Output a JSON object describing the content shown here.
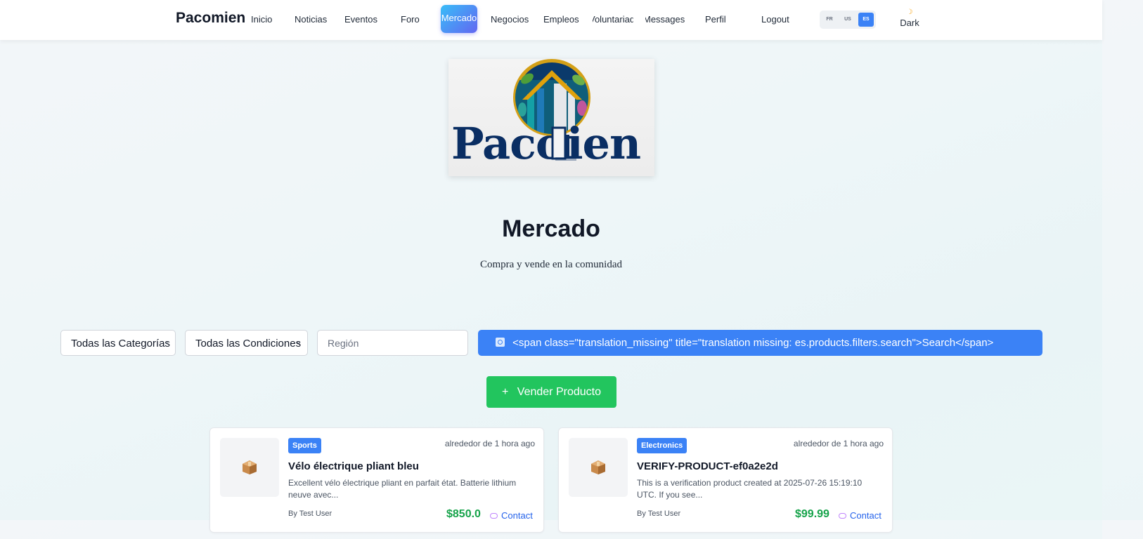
{
  "nav": {
    "brand": "Pacomien",
    "items": [
      "Inicio",
      "Noticias",
      "Eventos",
      "Foro",
      "Mercado",
      "Negocios",
      "Empleos",
      "Voluntariado",
      "Messages",
      "Perfil",
      "Logout"
    ],
    "active": "Mercado",
    "languages": [
      "FR",
      "US",
      "ES"
    ],
    "active_language": "ES",
    "theme_toggle": "Dark"
  },
  "hero": {
    "title": "Mercado",
    "subtitle": "Compra y vende en la comunidad"
  },
  "filters": {
    "category": "Todas las Categorías",
    "condition": "Todas las Condiciones",
    "region_placeholder": "Región",
    "search_label": "<span class=\"translation_missing\" title=\"translation missing: es.products.filters.search\">Search</span>"
  },
  "sell_button": "Vender Producto",
  "products": [
    {
      "category": "Sports",
      "time": "alrededor de 1 hora ago",
      "title": "Vélo électrique pliant bleu",
      "description": "Excellent vélo électrique pliant en parfait état. Batterie lithium neuve avec...",
      "author": "By Test User",
      "price": "$850.0",
      "contact": "Contact"
    },
    {
      "category": "Electronics",
      "time": "alrededor de 1 hora ago",
      "title": "VERIFY-PRODUCT-ef0a2e2d",
      "description": "This is a verification product created at 2025-07-26 15:19:10 UTC. If you see...",
      "author": "By Test User",
      "price": "$99.99",
      "contact": "Contact"
    }
  ],
  "colors": {
    "accent": "#3b82f6",
    "success": "#22c55e",
    "price": "#16a34a"
  },
  "icons": {
    "logo": "pacomien-logo",
    "search": "search-icon",
    "product_thumb": "package-icon",
    "contact": "chat-icon",
    "theme": "moon-icon"
  }
}
